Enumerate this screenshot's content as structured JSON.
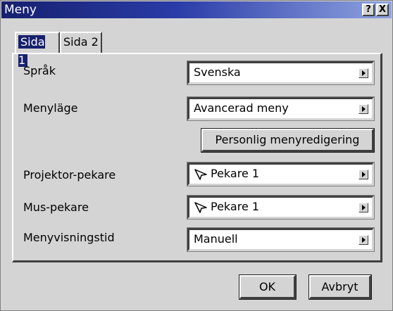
{
  "window": {
    "title": "Meny",
    "help_label": "?",
    "close_label": "X"
  },
  "tabs": [
    {
      "label": "Sida 1",
      "active": true
    },
    {
      "label": "Sida 2",
      "active": false
    }
  ],
  "settings": {
    "language": {
      "label": "Språk",
      "value": "Svenska"
    },
    "menu_mode": {
      "label": "Menyläge",
      "value": "Avancerad meny"
    },
    "custom_menu_button": "Personlig menyredigering",
    "projector_pointer": {
      "label": "Projektor-pekare",
      "value": "Pekare 1",
      "icon": "pointer-cursor-icon"
    },
    "mouse_pointer": {
      "label": "Mus-pekare",
      "value": "Pekare 1",
      "icon": "pointer-cursor-icon"
    },
    "menu_display_time": {
      "label": "Menyvisningstid",
      "value": "Manuell"
    }
  },
  "buttons": {
    "ok": "OK",
    "cancel": "Avbryt"
  },
  "colors": {
    "titlebar_start": "#16206e",
    "titlebar_end": "#8fa3e0",
    "face": "#d4d4d4",
    "field_bg": "#ffffff"
  }
}
